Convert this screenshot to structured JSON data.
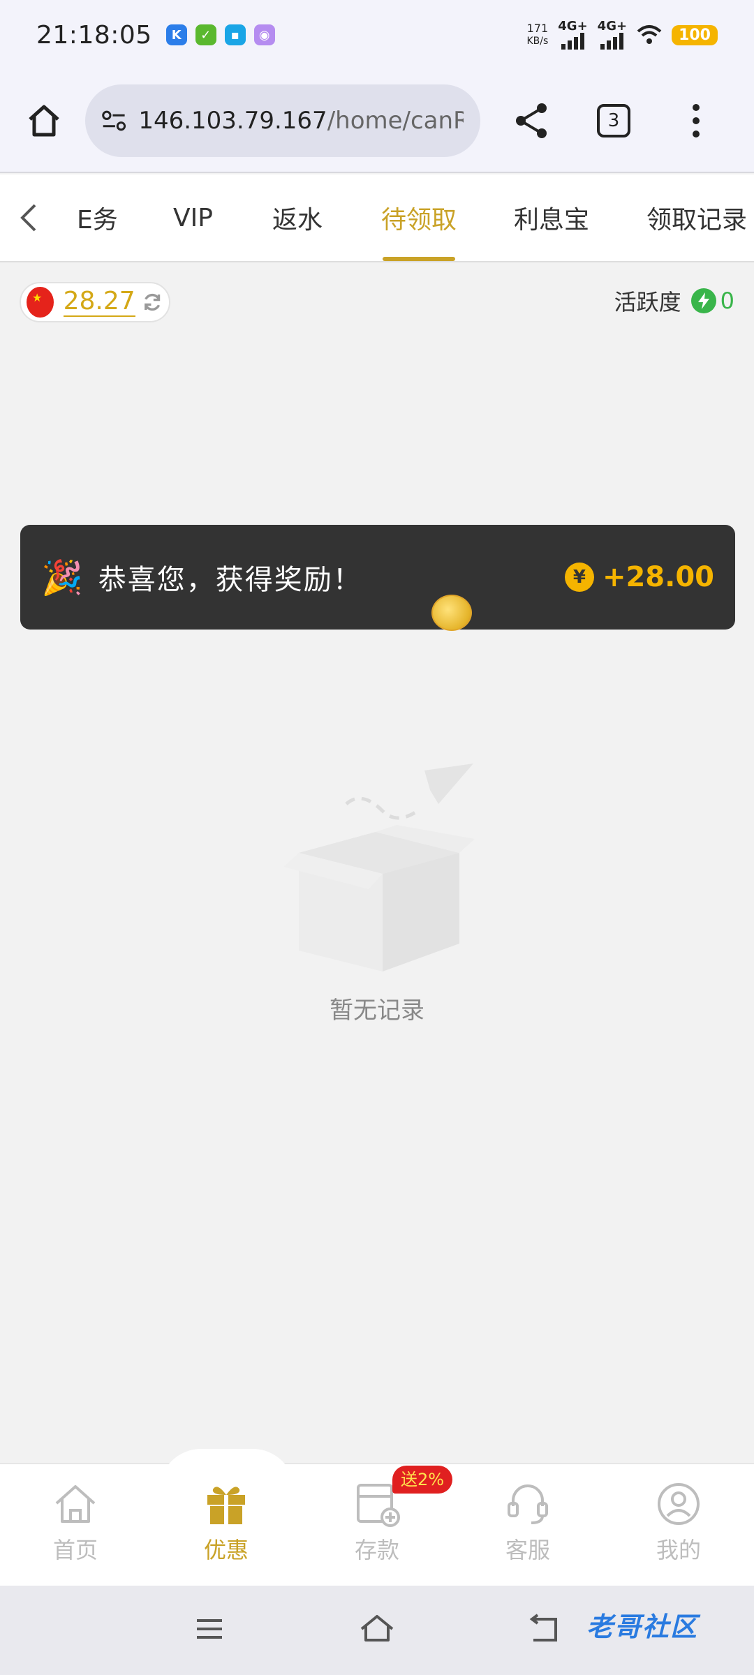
{
  "status_bar": {
    "time": "21:18:05",
    "net_speed_value": "171",
    "net_speed_unit": "KB/s",
    "signal1_label": "4G+",
    "signal2_label": "4G+",
    "battery": "100",
    "app_icons": [
      "k-app-icon",
      "checklist-app-icon",
      "cloud-app-icon",
      "purple-app-icon"
    ]
  },
  "browser": {
    "url_host": "146.103.79.167",
    "url_path": "/home/canRecei",
    "tab_count": "3"
  },
  "nav_tabs": {
    "items": [
      {
        "label": "E务"
      },
      {
        "label": "VIP"
      },
      {
        "label": "返水"
      },
      {
        "label": "待领取"
      },
      {
        "label": "利息宝"
      },
      {
        "label": "领取记录"
      }
    ],
    "active_index": 3,
    "active_color": "#c9a227"
  },
  "balance": {
    "amount": "28.27",
    "flag": "china-flag-icon"
  },
  "activity": {
    "label": "活跃度",
    "value": "0"
  },
  "toast": {
    "message": "恭喜您，获得奖励！",
    "amount": "+28.00",
    "currency_symbol": "¥"
  },
  "empty_state": {
    "text": "暂无记录"
  },
  "bottom_nav": {
    "items": [
      {
        "label": "首页",
        "icon": "home-icon"
      },
      {
        "label": "优惠",
        "icon": "gift-icon"
      },
      {
        "label": "存款",
        "icon": "deposit-icon"
      },
      {
        "label": "客服",
        "icon": "headset-icon"
      },
      {
        "label": "我的",
        "icon": "profile-icon"
      }
    ],
    "active_index": 1,
    "promo_badge": "送2%"
  },
  "watermark": "老哥社区",
  "colors": {
    "accent": "#c9a227",
    "toast_bg": "#333333",
    "positive": "#39b54a",
    "promo": "#e02020"
  }
}
